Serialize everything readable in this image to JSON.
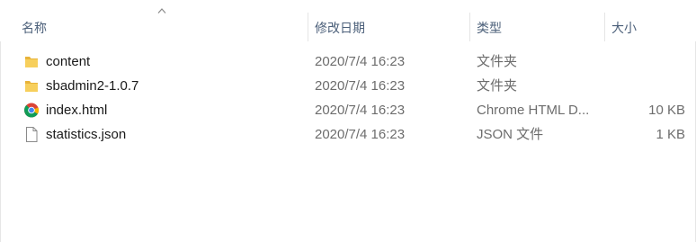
{
  "columns": {
    "name": "名称",
    "date": "修改日期",
    "type": "类型",
    "size": "大小"
  },
  "sort": {
    "column": "name",
    "direction": "ascending",
    "icon": "sort-up-chevron-icon"
  },
  "files": [
    {
      "icon": "folder-icon",
      "name": "content",
      "date": "2020/7/4 16:23",
      "type": "文件夹",
      "size": ""
    },
    {
      "icon": "folder-icon",
      "name": "sbadmin2-1.0.7",
      "date": "2020/7/4 16:23",
      "type": "文件夹",
      "size": ""
    },
    {
      "icon": "chrome-icon",
      "name": "index.html",
      "date": "2020/7/4 16:23",
      "type": "Chrome HTML D...",
      "size": "10 KB"
    },
    {
      "icon": "document-icon",
      "name": "statistics.json",
      "date": "2020/7/4 16:23",
      "type": "JSON 文件",
      "size": "1 KB"
    }
  ],
  "colors": {
    "folder": "#f5c74a",
    "header_text": "#4c607a",
    "detail_text": "#6d6d6d"
  }
}
